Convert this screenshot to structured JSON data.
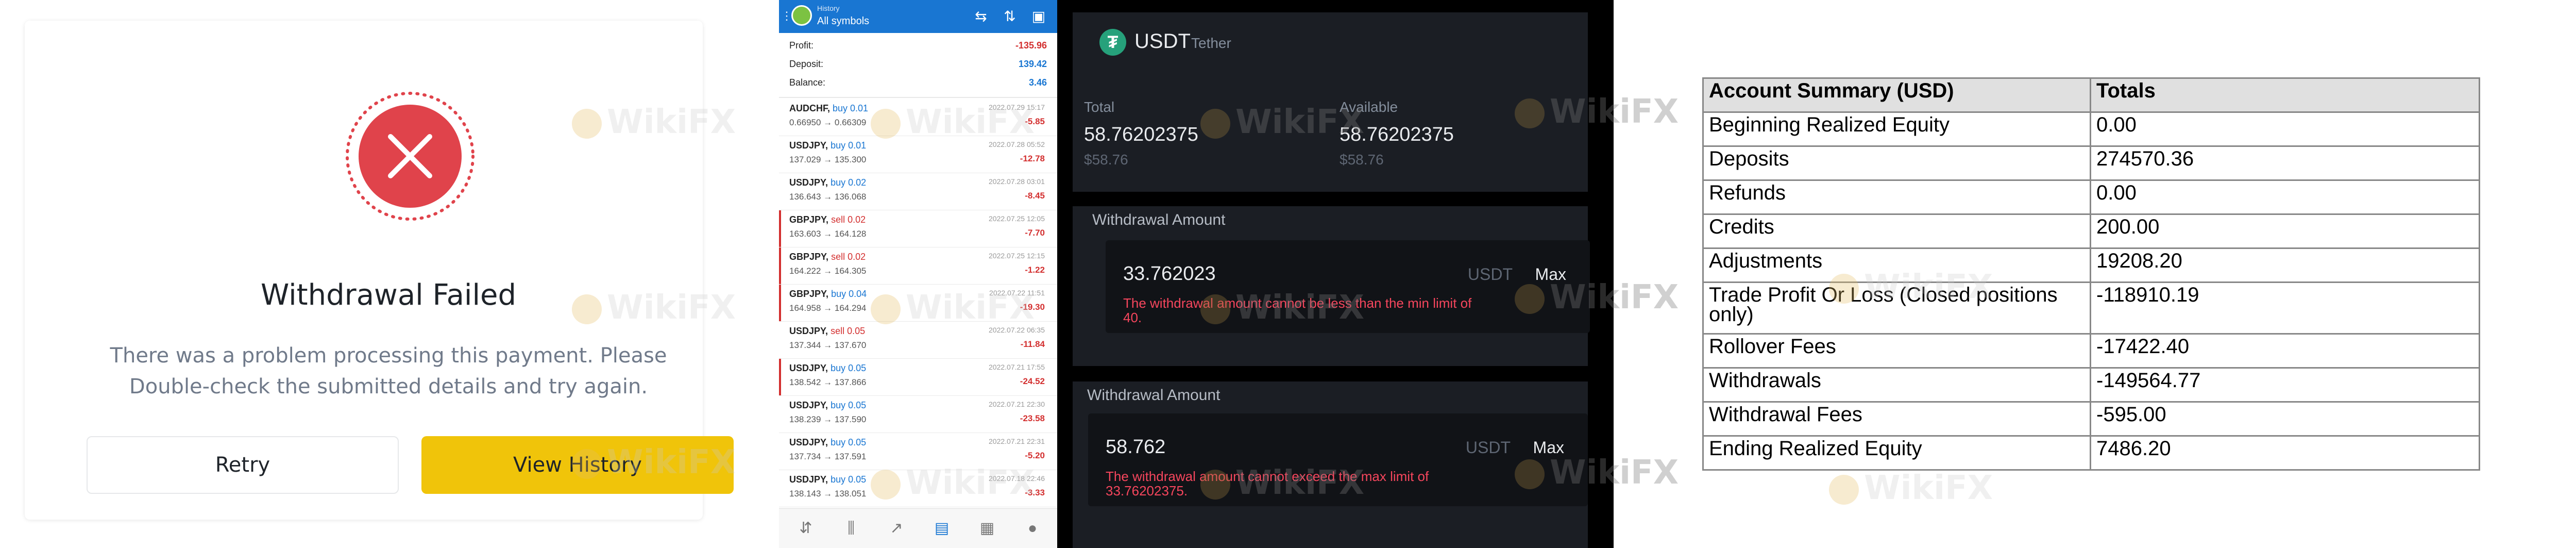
{
  "withdrawal_failed": {
    "title": "Withdrawal Failed",
    "message": "There was a problem processing this payment. Please Double-check the submitted details and try again.",
    "retry_label": "Retry",
    "view_history_label": "View History",
    "accent_color": "#e0434b",
    "button_color": "#f0c40a"
  },
  "mt4_history": {
    "header": {
      "title": "History",
      "subtitle": "All symbols"
    },
    "summary": [
      {
        "label": "Profit:",
        "value": "-135.96",
        "color": "#d32f2f"
      },
      {
        "label": "Deposit:",
        "value": "139.42",
        "color": "#1976d2"
      },
      {
        "label": "Balance:",
        "value": "3.46",
        "color": "#1976d2"
      }
    ],
    "trades": [
      {
        "symbol": "AUDCHF,",
        "side": "buy 0.01",
        "side_color": "#1976d2",
        "prices": "0.66950 → 0.66309",
        "date": "2022.07.29 15:17",
        "pl": "-5.85",
        "sell": false
      },
      {
        "symbol": "USDJPY,",
        "side": "buy 0.01",
        "side_color": "#1976d2",
        "prices": "137.029 → 135.300",
        "date": "2022.07.28 05:52",
        "pl": "-12.78",
        "sell": false
      },
      {
        "symbol": "USDJPY,",
        "side": "buy 0.02",
        "side_color": "#1976d2",
        "prices": "136.643 → 136.068",
        "date": "2022.07.28 03:01",
        "pl": "-8.45",
        "sell": false
      },
      {
        "symbol": "GBPJPY,",
        "side": "sell 0.02",
        "side_color": "#d32f2f",
        "prices": "163.603 → 164.128",
        "date": "2022.07.25 12:05",
        "pl": "-7.70",
        "sell": true
      },
      {
        "symbol": "GBPJPY,",
        "side": "sell 0.02",
        "side_color": "#d32f2f",
        "prices": "164.222 → 164.305",
        "date": "2022.07.25 12:15",
        "pl": "-1.22",
        "sell": true
      },
      {
        "symbol": "GBPJPY,",
        "side": "buy 0.04",
        "side_color": "#1976d2",
        "prices": "164.958 → 164.294",
        "date": "2022.07.22 11:51",
        "pl": "-19.30",
        "sell": true
      },
      {
        "symbol": "USDJPY,",
        "side": "sell 0.05",
        "side_color": "#d32f2f",
        "prices": "137.344 → 137.670",
        "date": "2022.07.22 06:35",
        "pl": "-11.84",
        "sell": false
      },
      {
        "symbol": "USDJPY,",
        "side": "buy 0.05",
        "side_color": "#1976d2",
        "prices": "138.542 → 137.866",
        "date": "2022.07.21 17:55",
        "pl": "-24.52",
        "sell": true
      },
      {
        "symbol": "USDJPY,",
        "side": "buy 0.05",
        "side_color": "#1976d2",
        "prices": "138.239 → 137.590",
        "date": "2022.07.21 22:30",
        "pl": "-23.58",
        "sell": false
      },
      {
        "symbol": "USDJPY,",
        "side": "buy 0.05",
        "side_color": "#1976d2",
        "prices": "137.734 → 137.591",
        "date": "2022.07.21 22:31",
        "pl": "-5.20",
        "sell": false
      },
      {
        "symbol": "USDJPY,",
        "side": "buy 0.05",
        "side_color": "#1976d2",
        "prices": "138.143 → 138.051",
        "date": "2022.07.18 22:46",
        "pl": "-3.33",
        "sell": false
      }
    ]
  },
  "usdt_withdraw": {
    "coin": "USDT",
    "coin_name": "Tether",
    "total_label": "Total",
    "total_value": "58.76202375",
    "total_usd": "$58.76",
    "available_label": "Available",
    "available_value": "58.76202375",
    "available_usd": "$58.76",
    "form1": {
      "title": "Withdrawal Amount",
      "amount": "33.762023",
      "unit": "USDT",
      "max_label": "Max",
      "error": "The withdrawal amount cannot be less than the min limit of 40."
    },
    "form2": {
      "title": "Withdrawal Amount",
      "amount": "58.762",
      "unit": "USDT",
      "max_label": "Max",
      "error": "The withdrawal amount cannot exceed the max limit of 33.76202375."
    }
  },
  "account_summary": {
    "headers": [
      "Account Summary (USD)",
      "Totals"
    ],
    "rows": [
      [
        "Beginning Realized Equity",
        "0.00"
      ],
      [
        "Deposits",
        "274570.36"
      ],
      [
        "Refunds",
        "0.00"
      ],
      [
        "Credits",
        "200.00"
      ],
      [
        "Adjustments",
        "19208.20"
      ],
      [
        "Trade Profit Or Loss (Closed positions only)",
        "-118910.19"
      ],
      [
        "Rollover Fees",
        "-17422.40"
      ],
      [
        "Withdrawals",
        "-149564.77"
      ],
      [
        "Withdrawal Fees",
        "-595.00"
      ],
      [
        "Ending Realized Equity",
        "7486.20"
      ]
    ]
  },
  "watermark": {
    "text": "WikiFX"
  }
}
